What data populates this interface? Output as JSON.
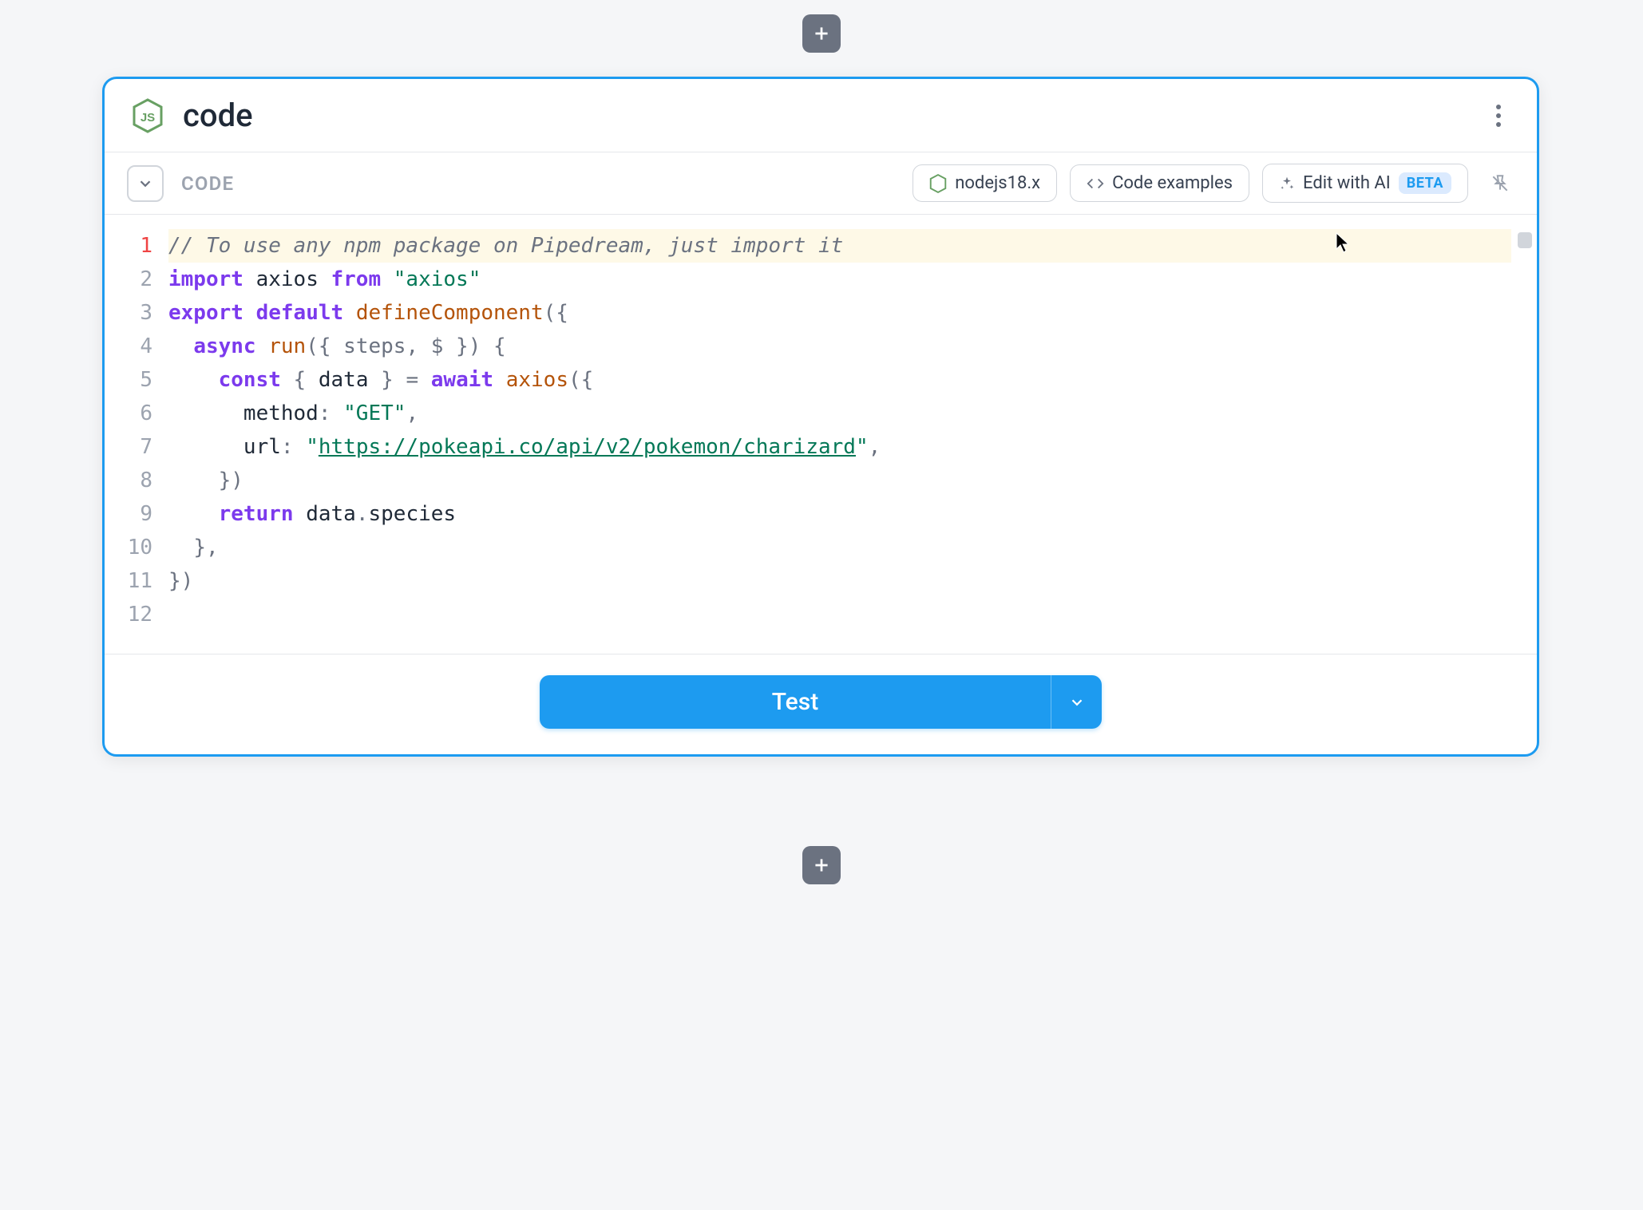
{
  "step": {
    "title": "code",
    "section_label": "CODE"
  },
  "toolbar": {
    "runtime": "nodejs18.x",
    "examples_label": "Code examples",
    "ai_label": "Edit with AI",
    "ai_badge": "BETA"
  },
  "editor": {
    "lines": [
      {
        "n": 1,
        "tokens": [
          [
            "comment",
            "// To use any npm package on Pipedream, just import it"
          ]
        ]
      },
      {
        "n": 2,
        "tokens": [
          [
            "keyword",
            "import"
          ],
          [
            "ident",
            " axios "
          ],
          [
            "keyword",
            "from"
          ],
          [
            "ident",
            " "
          ],
          [
            "string",
            "\"axios\""
          ]
        ]
      },
      {
        "n": 3,
        "tokens": [
          [
            "ident",
            ""
          ]
        ]
      },
      {
        "n": 4,
        "tokens": [
          [
            "keyword",
            "export"
          ],
          [
            "ident",
            " "
          ],
          [
            "keyword",
            "default"
          ],
          [
            "ident",
            " "
          ],
          [
            "func",
            "defineComponent"
          ],
          [
            "punct",
            "({"
          ]
        ]
      },
      {
        "n": 5,
        "tokens": [
          [
            "ident",
            "  "
          ],
          [
            "keyword",
            "async"
          ],
          [
            "ident",
            " "
          ],
          [
            "func",
            "run"
          ],
          [
            "punct",
            "("
          ],
          [
            "param",
            "{ steps, $ }"
          ],
          [
            "punct",
            ") {"
          ]
        ]
      },
      {
        "n": 6,
        "tokens": [
          [
            "ident",
            "    "
          ],
          [
            "keyword",
            "const"
          ],
          [
            "punct",
            " { "
          ],
          [
            "ident",
            "data"
          ],
          [
            "punct",
            " } = "
          ],
          [
            "keyword",
            "await"
          ],
          [
            "ident",
            " "
          ],
          [
            "func",
            "axios"
          ],
          [
            "punct",
            "({"
          ]
        ]
      },
      {
        "n": 7,
        "tokens": [
          [
            "ident",
            "      method"
          ],
          [
            "punct",
            ": "
          ],
          [
            "string",
            "\"GET\""
          ],
          [
            "punct",
            ","
          ]
        ]
      },
      {
        "n": 8,
        "tokens": [
          [
            "ident",
            "      url"
          ],
          [
            "punct",
            ": "
          ],
          [
            "string",
            "\""
          ],
          [
            "url",
            "https://pokeapi.co/api/v2/pokemon/charizard"
          ],
          [
            "string",
            "\""
          ],
          [
            "punct",
            ","
          ]
        ]
      },
      {
        "n": 9,
        "tokens": [
          [
            "ident",
            "    "
          ],
          [
            "punct",
            "})"
          ]
        ]
      },
      {
        "n": 10,
        "tokens": [
          [
            "ident",
            "    "
          ],
          [
            "keyword",
            "return"
          ],
          [
            "ident",
            " data"
          ],
          [
            "punct",
            "."
          ],
          [
            "ident",
            "species"
          ]
        ]
      },
      {
        "n": 11,
        "tokens": [
          [
            "ident",
            "  "
          ],
          [
            "punct",
            "},"
          ]
        ]
      },
      {
        "n": 12,
        "tokens": [
          [
            "punct",
            "})"
          ]
        ]
      }
    ],
    "current_line": 1
  },
  "footer": {
    "test_label": "Test"
  }
}
